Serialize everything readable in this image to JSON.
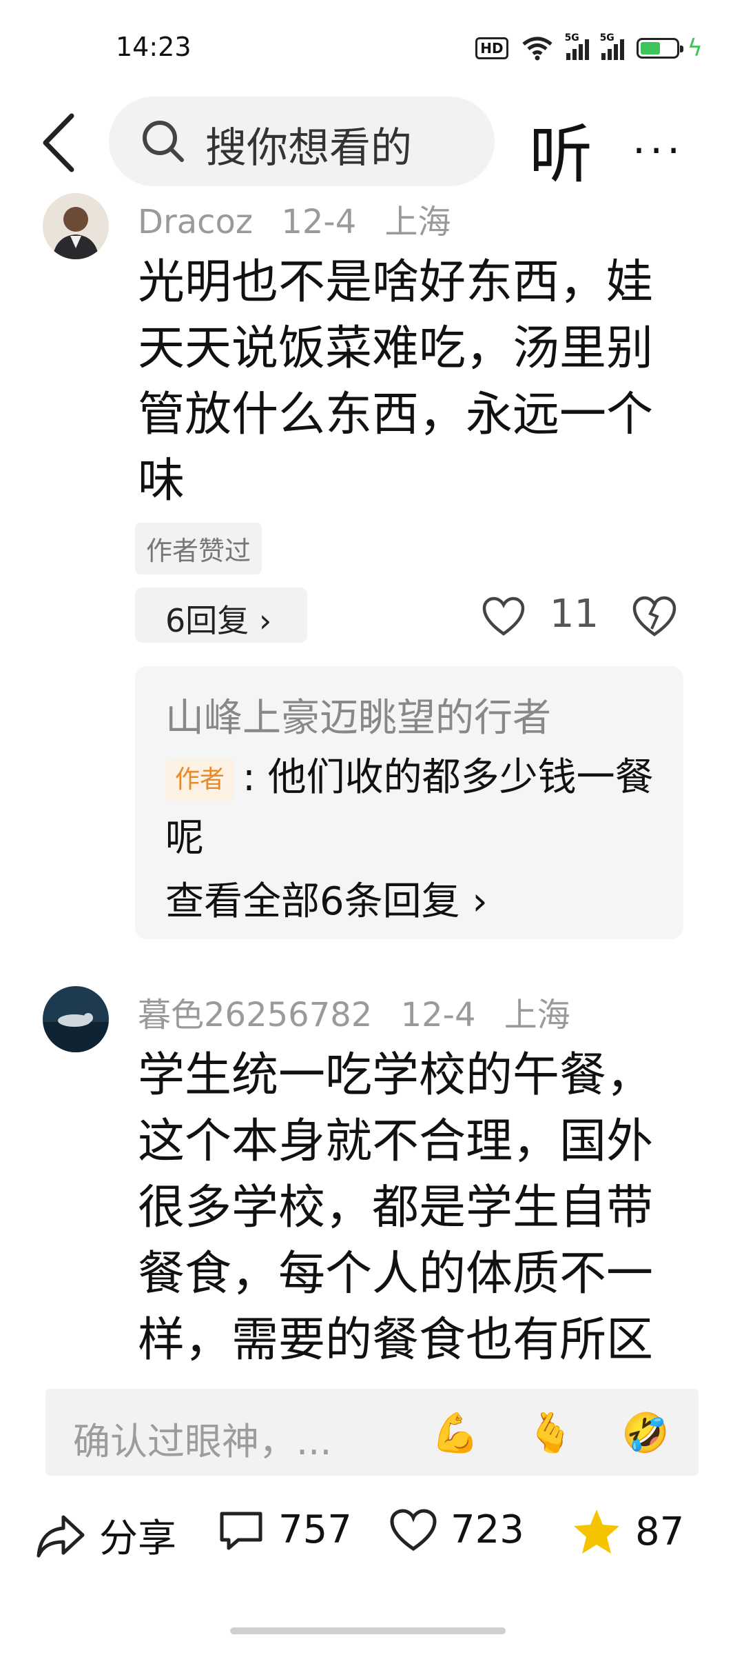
{
  "status_bar": {
    "time": "14:23",
    "hd_label": "HD",
    "net1": "5G",
    "net2": "5G"
  },
  "nav": {
    "search_placeholder": "搜你想看的",
    "listen_label": "听",
    "more_label": "···"
  },
  "comments": [
    {
      "username": "Dracoz",
      "date": "12-4",
      "location": "上海",
      "text": "光明也不是啥好东西，娃天天说饭菜难吃，汤里别管放什么东西，永远一个味",
      "tag": "作者赞过",
      "reply_button": "6回复 ›",
      "like_count": "11",
      "sub_reply": {
        "name": "山峰上豪迈眺望的行者",
        "author_badge": "作者",
        "text": ": 他们收的都多少钱一餐呢",
        "view_all": "查看全部6条回复 ›"
      }
    },
    {
      "username": "暮色26256782",
      "date": "12-4",
      "location": "上海",
      "text": "学生统一吃学校的午餐，这个本身就不合理，国外很多学校，都是学生自带餐食，每个人的体质不一样，需要的餐食也有所区"
    }
  ],
  "input": {
    "placeholder": "确认过眼神，...",
    "emojis": [
      "💪",
      "🫰",
      "🤣"
    ]
  },
  "bottom_bar": {
    "share_label": "分享",
    "comment_count": "757",
    "like_count": "723",
    "star_count": "87"
  },
  "colors": {
    "accent_star": "#f5c400",
    "battery": "#3cc35a",
    "author_badge_text": "#e68a2a"
  }
}
